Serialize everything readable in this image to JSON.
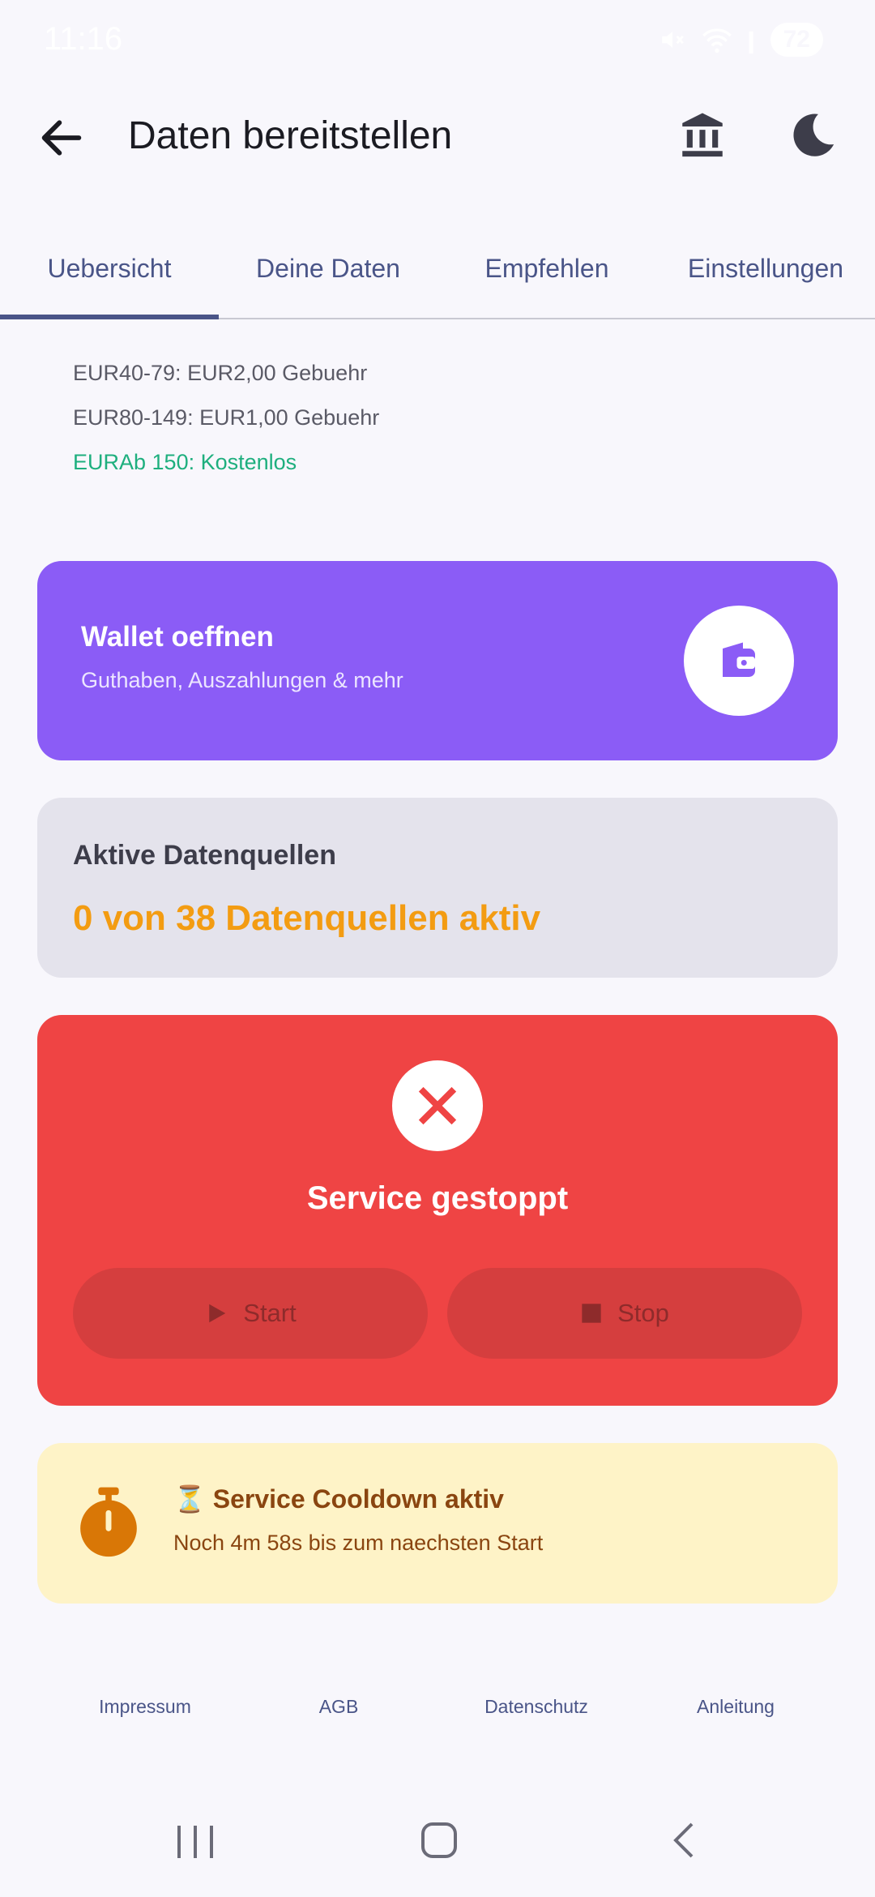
{
  "status_bar": {
    "time": "11:16",
    "battery": "72",
    "icons": [
      "mute-icon",
      "wifi-icon",
      "signal-icon",
      "battery-icon"
    ]
  },
  "app_bar": {
    "title": "Daten bereitstellen",
    "icons": [
      "back-arrow-icon",
      "bank-icon",
      "moon-icon"
    ]
  },
  "tabs": [
    {
      "label": "Uebersicht",
      "active": true
    },
    {
      "label": "Deine Daten",
      "active": false
    },
    {
      "label": "Empfehlen",
      "active": false
    },
    {
      "label": "Einstellungen",
      "active": false
    }
  ],
  "fees": [
    "EUR40-79: EUR2,00 Gebuehr",
    "EUR80-149: EUR1,00 Gebuehr",
    "EURAb 150: Kostenlos"
  ],
  "wallet": {
    "title": "Wallet oeffnen",
    "subtitle": "Guthaben, Auszahlungen & mehr",
    "icon": "wallet-icon"
  },
  "sources": {
    "title": "Aktive Datenquellen",
    "value": "0 von 38 Datenquellen aktiv"
  },
  "service": {
    "status": "Service gestoppt",
    "status_icon": "close-icon",
    "start_label": "Start",
    "stop_label": "Stop"
  },
  "cooldown": {
    "title": "⏳ Service Cooldown aktiv",
    "subtitle": "Noch 4m 58s bis zum naechsten Start",
    "icon": "stopwatch-icon"
  },
  "footer": {
    "links": [
      "Impressum",
      "AGB",
      "Datenschutz",
      "Anleitung"
    ]
  },
  "colors": {
    "accent": "#4a5588",
    "wallet": "#8b5cf6",
    "service_stopped": "#ef4444",
    "warning_text": "#f39c12",
    "success_text": "#1eaf7e",
    "cooldown_bg": "#fef3c7"
  }
}
